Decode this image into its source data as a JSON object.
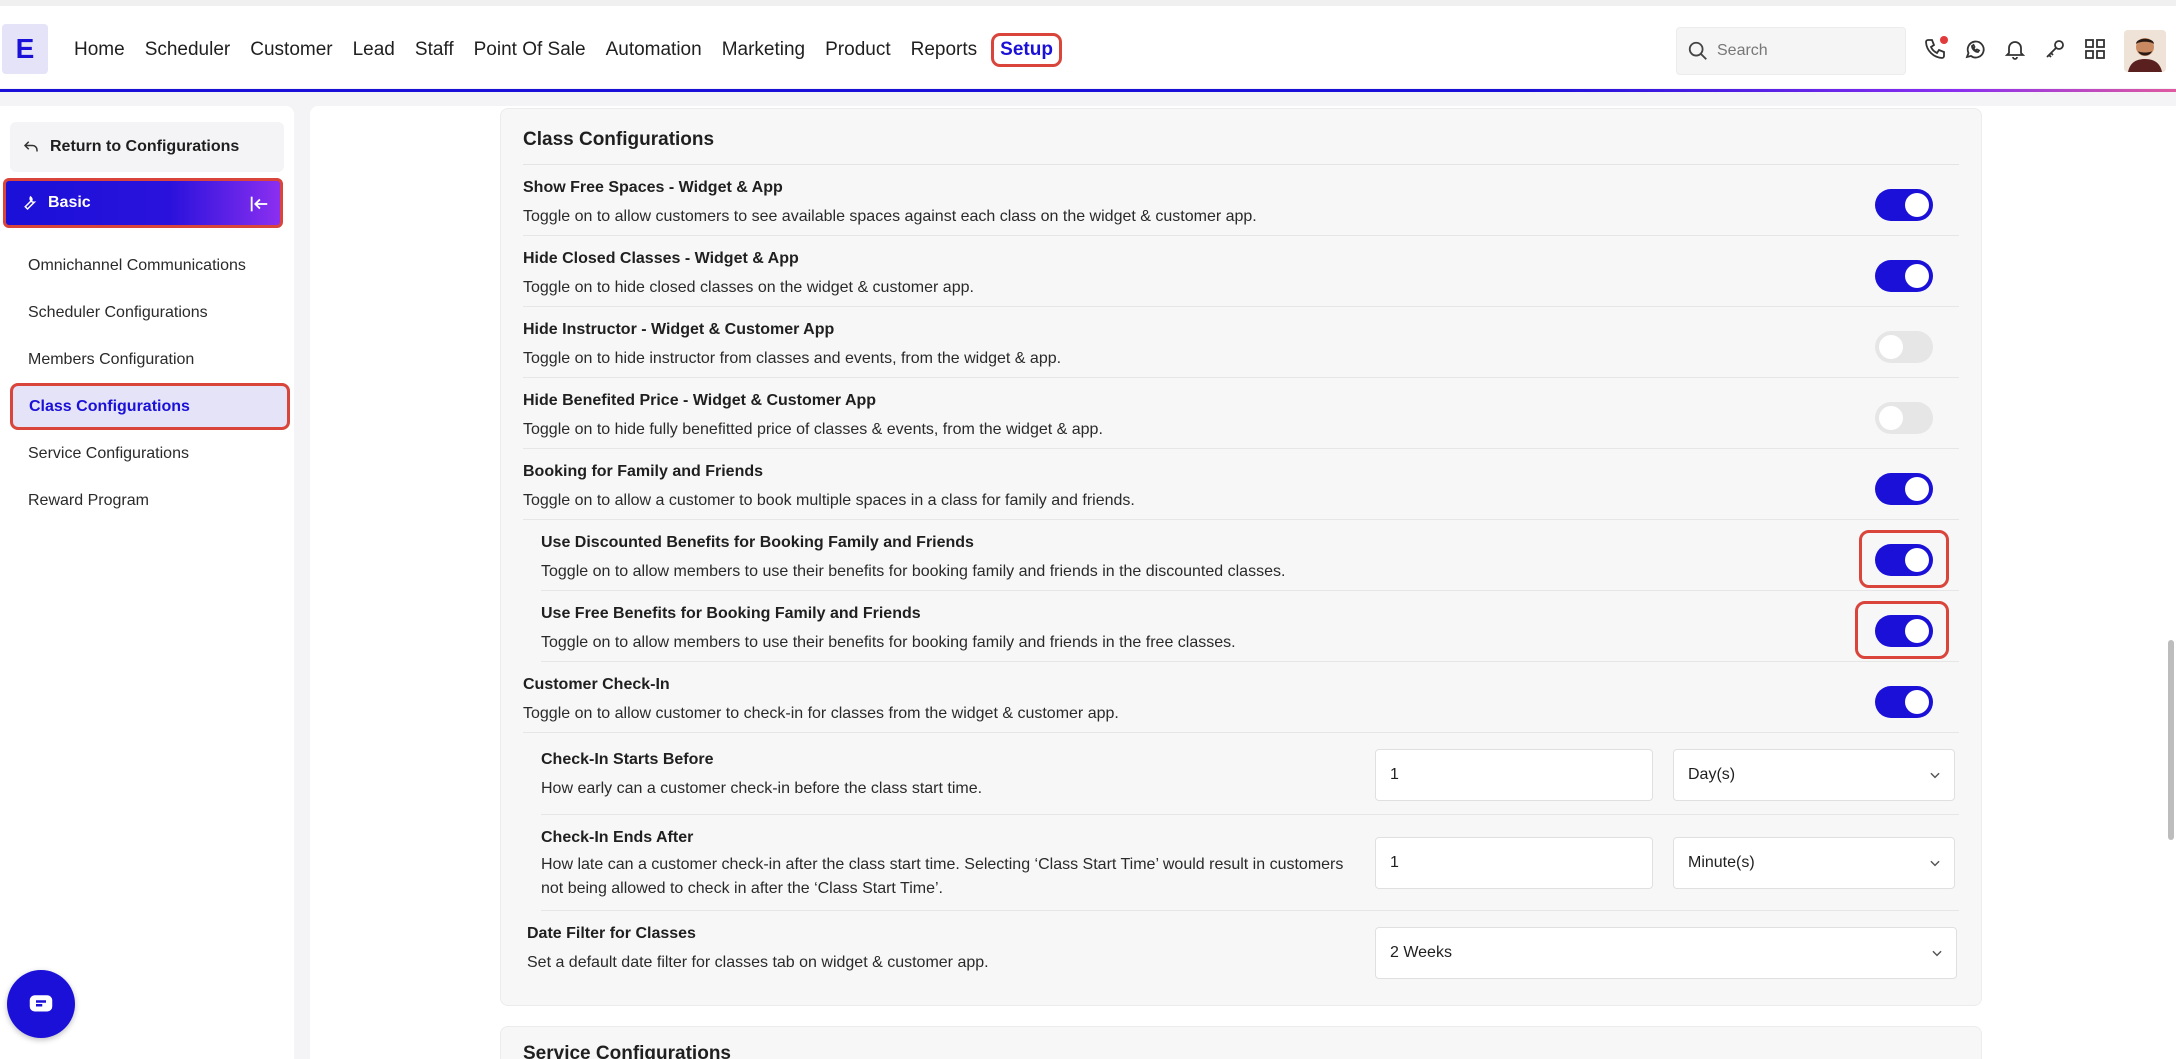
{
  "app": {
    "logo_letter": "E"
  },
  "nav": {
    "items": [
      "Home",
      "Scheduler",
      "Customer",
      "Lead",
      "Staff",
      "Point Of Sale",
      "Automation",
      "Marketing",
      "Product",
      "Reports"
    ],
    "active": "Setup"
  },
  "search": {
    "placeholder": "Search"
  },
  "top_icons": [
    "phone-icon",
    "whatsapp-icon",
    "bell-icon",
    "key-icon",
    "grid-icon"
  ],
  "sidebar": {
    "return_label": "Return to Configurations",
    "basic_label": "Basic",
    "items": [
      "Omnichannel Communications",
      "Scheduler Configurations",
      "Members Configuration",
      "Class Configurations",
      "Service Configurations",
      "Reward Program"
    ],
    "active_item": "Class Configurations"
  },
  "class_config": {
    "title": "Class Configurations",
    "settings": [
      {
        "title": "Show Free Spaces - Widget & App",
        "desc": "Toggle on to allow customers to see available spaces against each class on the widget & customer app.",
        "on": true
      },
      {
        "title": "Hide Closed Classes - Widget & App",
        "desc": "Toggle on to hide closed classes on the widget & customer app.",
        "on": true
      },
      {
        "title": "Hide Instructor - Widget & Customer App",
        "desc": "Toggle on to hide instructor from classes and events, from the widget & app.",
        "on": false
      },
      {
        "title": "Hide Benefited Price - Widget & Customer App",
        "desc": "Toggle on to hide fully benefitted price of classes & events, from the widget & app.",
        "on": false
      },
      {
        "title": "Booking for Family and Friends",
        "desc": "Toggle on to allow a customer to book multiple spaces in a class for family and friends.",
        "on": true
      },
      {
        "title": "Use Discounted Benefits for Booking Family and Friends",
        "desc": "Toggle on to allow members to use their benefits for booking family and friends in the discounted classes.",
        "on": true
      },
      {
        "title": "Use Free Benefits for Booking Family and Friends",
        "desc": "Toggle on to allow members to use their benefits for booking family and friends in the free classes.",
        "on": true
      },
      {
        "title": "Customer Check-In",
        "desc": "Toggle on to allow customer to check-in for classes from the widget & customer app.",
        "on": true
      }
    ],
    "checkin_start": {
      "title": "Check-In Starts Before",
      "desc": "How early can a customer check-in before the class start time.",
      "value": "1",
      "unit": "Day(s)"
    },
    "checkin_end": {
      "title": "Check-In Ends After",
      "desc": "How late can a customer check-in after the class start time. Selecting ‘Class Start Time’ would result in customers not being allowed to check in after the ‘Class Start Time’.",
      "value": "1",
      "unit": "Minute(s)"
    },
    "date_filter": {
      "title": "Date Filter for Classes",
      "desc": "Set a default date filter for classes tab on widget & customer app.",
      "value": "2 Weeks"
    }
  },
  "service_config": {
    "title": "Service Configurations"
  },
  "colors": {
    "accent": "#1a10d8",
    "highlight": "#d9453b"
  }
}
